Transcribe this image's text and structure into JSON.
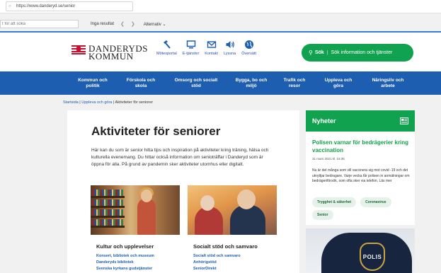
{
  "browser": {
    "address": "https://www.danderyd.se/senior",
    "find_placeholder": "t för att söka",
    "find_result": "Inga resultat",
    "find_options": "Alternativ"
  },
  "header": {
    "logo_line1": "DANDERYDS",
    "logo_line2": "KOMMUN",
    "quick_links": [
      {
        "label": "Mötesportal",
        "icon": "gavel-icon"
      },
      {
        "label": "E-tjänster",
        "icon": "monitor-icon"
      },
      {
        "label": "Kontakt",
        "icon": "mail-icon"
      },
      {
        "label": "Lyssna",
        "icon": "speaker-icon"
      },
      {
        "label": "Översätt",
        "icon": "globe-icon"
      }
    ],
    "search_label": "Sök",
    "search_hint": "Sök information och tjänster"
  },
  "nav": [
    {
      "line1": "Kommun och",
      "line2": "politik"
    },
    {
      "line1": "Förskola och",
      "line2": "skola"
    },
    {
      "line1": "Omsorg och socialt",
      "line2": "stöd"
    },
    {
      "line1": "Bygga, bo och",
      "line2": "miljö"
    },
    {
      "line1": "Trafik och",
      "line2": "resor"
    },
    {
      "line1": "Uppleva och",
      "line2": "göra"
    },
    {
      "line1": "Näringsliv och",
      "line2": "arbete"
    }
  ],
  "breadcrumb": {
    "items": [
      "Startsida",
      "Uppleva och göra"
    ],
    "current": "Aktiviteter för seniorer"
  },
  "main": {
    "title": "Aktiviteter för seniorer",
    "intro": "Här kan du som är senior hitta tips och inspiration på aktiviteter kring träning, hälsa och kulturella evenemang. Du hittar också information om senioträffar i Danderyd som är öppna för alla. På grund av pandemin sker aktiviteter utomhus eller digitalt.",
    "cards": [
      {
        "title": "Kultur och upplevelser",
        "links": [
          "Konsert, bibliotek och museum",
          "Danderyds bibliotek",
          "Svenska kyrkans gudstjänster"
        ]
      },
      {
        "title": "Socialt stöd och samvaro",
        "links": [
          "Socialt stöd och samvaro",
          "Anhörigstöd",
          "SeniorDirekt"
        ]
      }
    ]
  },
  "news": {
    "heading": "Nyheter",
    "title": "Polisen varnar för bedrägerier kring vaccination",
    "date": "31 mars 2021 kl. 15:36",
    "text": "Nu är det många som vill vaccinera sig mot covid -19 och det utnyttjar bedragare. Varje vecka får polisen in anmälningar om bedrägeriförsök, som ofta sker via telefon. Läs mer",
    "tags": [
      "Trygghet & säkerhet",
      "Coronavirus",
      "Senior"
    ],
    "image_badge": "POLIS"
  },
  "colors": {
    "brand_blue": "#1d5eb0",
    "brand_green": "#11a24f",
    "logo_red": "#c8102e"
  }
}
